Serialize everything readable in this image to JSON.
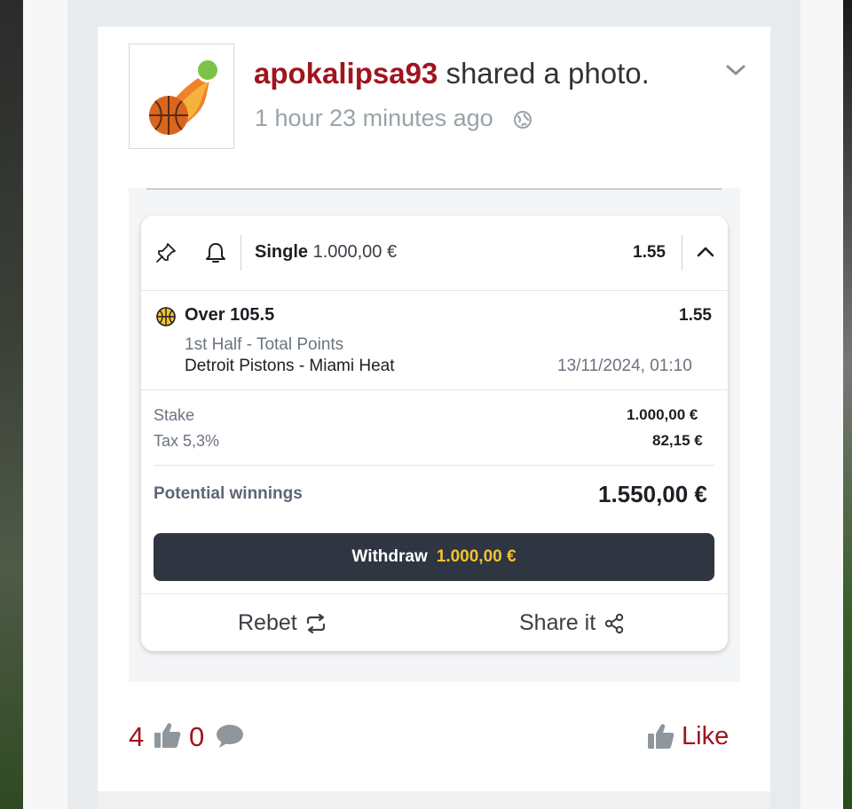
{
  "post": {
    "author": "apokalipsa93",
    "action": "shared a photo.",
    "time": "1 hour 23 minutes ago",
    "privacy_icon": "globe-icon",
    "menu_icon": "chevron-down-icon"
  },
  "bet_slip": {
    "header": {
      "type_label": "Single",
      "type_amount": "1.000,00 €",
      "total_odds": "1.55"
    },
    "selection": {
      "pick": "Over 105.5",
      "odds": "1.55",
      "market": "1st Half - Total Points",
      "match": "Detroit Pistons - Miami Heat",
      "datetime": "13/11/2024, 01:10"
    },
    "stake_label": "Stake",
    "stake_value": "1.000,00 €",
    "tax_label": "Tax 5,3%",
    "tax_value": "82,15 €",
    "potential_label": "Potential winnings",
    "potential_value": "1.550,00 €",
    "withdraw_label": "Withdraw",
    "withdraw_amount": "1.000,00 €",
    "rebet_label": "Rebet",
    "share_label": "Share it"
  },
  "footer": {
    "likes_count": "4",
    "comments_count": "0",
    "like_label": "Like"
  },
  "colors": {
    "author": "#a0141e",
    "withdraw_bg": "#2f3541",
    "withdraw_amount": "#f2c230",
    "online": "#7cc24a"
  }
}
